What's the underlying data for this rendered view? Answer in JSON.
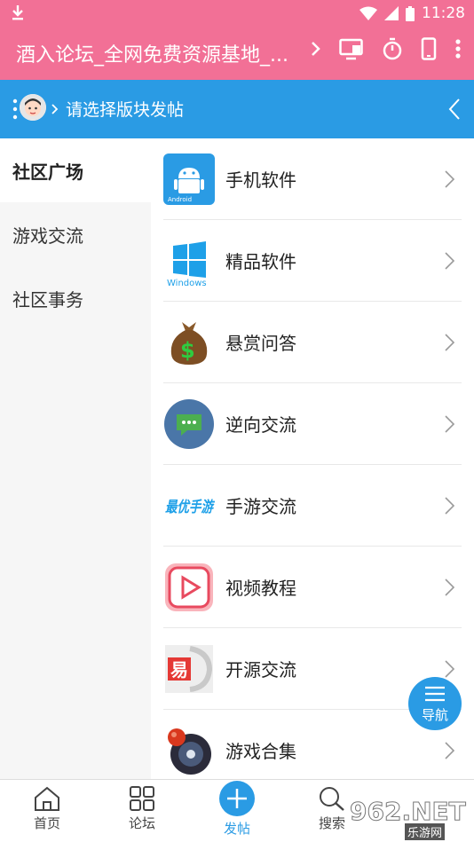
{
  "status_bar": {
    "time": "11:28"
  },
  "title_bar": {
    "title": "酒入论坛_全网免费资源基地_..."
  },
  "sub_bar": {
    "breadcrumb": "请选择版块发帖"
  },
  "sidebar": {
    "items": [
      {
        "label": "社区广场",
        "active": true
      },
      {
        "label": "游戏交流",
        "active": false
      },
      {
        "label": "社区事务",
        "active": false
      }
    ]
  },
  "forums": [
    {
      "label": "手机软件",
      "icon": "android-icon",
      "icon_text": "Android"
    },
    {
      "label": "精品软件",
      "icon": "windows-icon",
      "icon_text": "Windows"
    },
    {
      "label": "悬赏问答",
      "icon": "money-bag-icon",
      "icon_text": "$"
    },
    {
      "label": "逆向交流",
      "icon": "chat-bubble-icon"
    },
    {
      "label": "手游交流",
      "icon": "mobile-game-icon",
      "icon_text": "最优手游"
    },
    {
      "label": "视频教程",
      "icon": "video-play-icon"
    },
    {
      "label": "开源交流",
      "icon": "open-source-icon",
      "icon_text": "易"
    },
    {
      "label": "游戏合集",
      "icon": "game-disc-icon"
    }
  ],
  "fab": {
    "label": "导航"
  },
  "tab_bar": {
    "tabs": [
      {
        "label": "首页",
        "icon": "home-icon"
      },
      {
        "label": "论坛",
        "icon": "grid-icon"
      },
      {
        "label": "发帖",
        "icon": "plus-icon"
      },
      {
        "label": "搜索",
        "icon": "search-icon"
      }
    ]
  },
  "watermark": {
    "brand": "962.NET",
    "sub": "乐游网"
  },
  "colors": {
    "title_bar": "#f27096",
    "accent": "#2a9be4",
    "sidebar_bg": "#f6f6f6"
  }
}
